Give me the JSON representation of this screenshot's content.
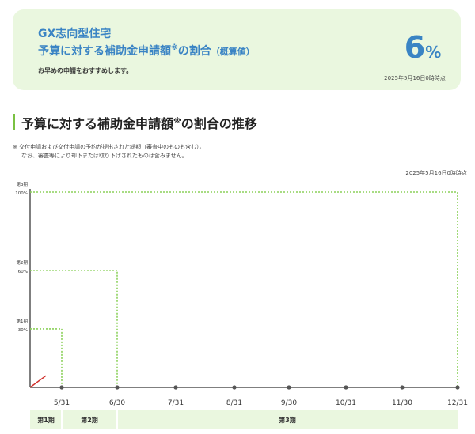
{
  "summary": {
    "title_line1": "GX志向型住宅",
    "title_line2": "予算に対する補助金申請額",
    "title_mark": "※",
    "title_line2_suffix": "の割合",
    "title_qualifier": "（概算値）",
    "note": "お早めの申請をおすすめします。",
    "percent_value": "6",
    "percent_unit": "%",
    "as_of": "2025年5月16日0時時点"
  },
  "section": {
    "heading": "予算に対する補助金申請額",
    "heading_mark": "※",
    "heading_suffix": "の割合の推移",
    "footnote_line1": "※ 交付申請および交付申請の予約が提出された総額（審査中のものも含む）。",
    "footnote_line2": "なお、審査等により却下または取り下げされたものは含みません。",
    "as_of": "2025年5月16日0時時点"
  },
  "colors": {
    "accent_blue": "#3a84c4",
    "summary_bg": "#eaf7df",
    "threshold_green": "#8bd15a",
    "actual_red": "#d0302b",
    "axis": "#555555",
    "period_bar_bg": "#eaf7df"
  },
  "chart_data": {
    "type": "line",
    "ylim": [
      0,
      100
    ],
    "x_ticks": [
      "5/31",
      "6/30",
      "7/31",
      "8/31",
      "9/30",
      "10/31",
      "11/30",
      "12/31"
    ],
    "thresholds": [
      {
        "period": "第1期",
        "level_label": "30%",
        "value": 30,
        "end_tick": "5/31"
      },
      {
        "period": "第2期",
        "level_label": "60%",
        "value": 60,
        "end_tick": "6/30"
      },
      {
        "period": "第3期",
        "level_label": "100%",
        "value": 100,
        "end_tick": "12/31"
      }
    ],
    "actual": {
      "dates": [
        "2025-05-01",
        "2025-05-16"
      ],
      "values": [
        0,
        6
      ]
    },
    "periods": [
      "第1期",
      "第2期",
      "第3期"
    ]
  }
}
